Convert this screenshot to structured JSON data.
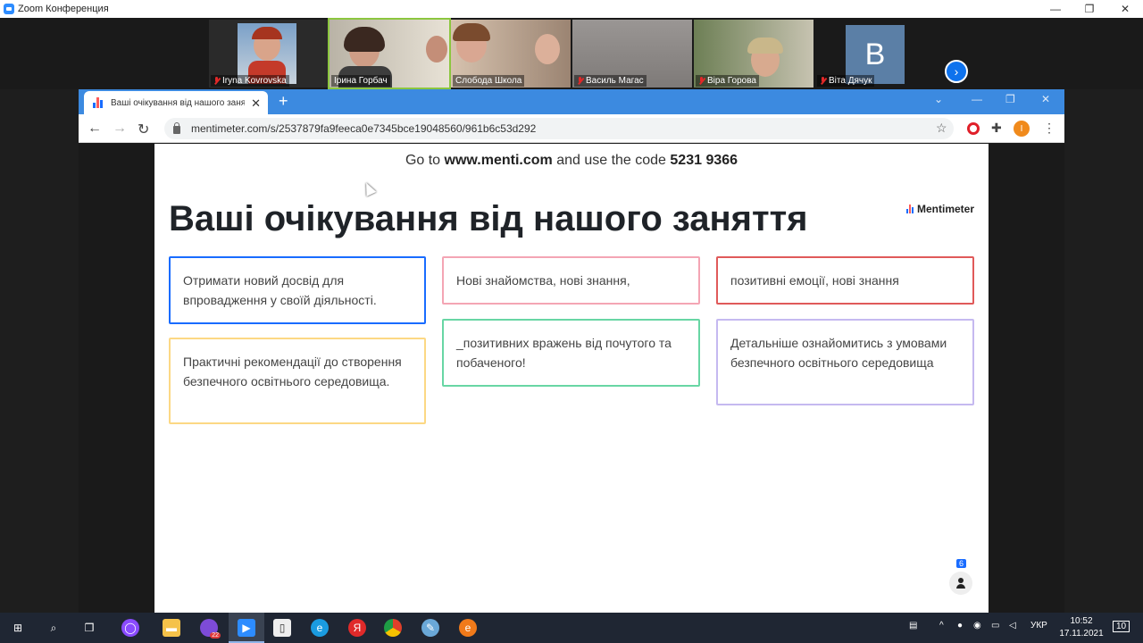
{
  "zoom": {
    "title": "Zoom Конференция",
    "participants": [
      {
        "name": "Iryna Kovrovska",
        "muted": true
      },
      {
        "name": "Ірина Горбач",
        "muted": false
      },
      {
        "name": "Слобода Школа",
        "muted": false
      },
      {
        "name": "Василь Магас",
        "muted": true
      },
      {
        "name": "Віра Горова",
        "muted": true
      },
      {
        "name": "Віта Дячук",
        "muted": true,
        "avatar_letter": "B"
      }
    ]
  },
  "browser": {
    "tab_title": "Ваші очікування від нашого заняття",
    "url": "mentimeter.com/s/2537879fa9feeca0e7345bce19048560/961b6c53d292"
  },
  "page": {
    "join_prefix": "Go to",
    "join_site": "www.menti.com",
    "join_middle": "and use the code",
    "join_code": "5231 9366",
    "headline": "Ваші очікування від нашого заняття",
    "brand": "Mentimeter",
    "responses": [
      {
        "text": "Отримати новий досвід для впровадження у своїй діяльності.",
        "color": "#196cff"
      },
      {
        "text": "Нові знайомства, нові знання,",
        "color": "#f4a5b4"
      },
      {
        "text": "позитивні емоції, нові знання",
        "color": "#e05a5a"
      },
      {
        "text": "Практичні рекомендації до створення безпечного освітнього середовища.",
        "color": "#fcd884"
      },
      {
        "text": "_позитивних вражень від почутого та побаченого!",
        "color": "#68d6a4"
      },
      {
        "text": "Детальніше ознайомитись з умовами безпечного освітнього середовища",
        "color": "#c5b9f0"
      }
    ],
    "participant_count": "6"
  },
  "taskbar": {
    "viber_badge": "22",
    "language": "УКР",
    "time": "10:52",
    "date": "17.11.2021",
    "notifications": "10"
  }
}
